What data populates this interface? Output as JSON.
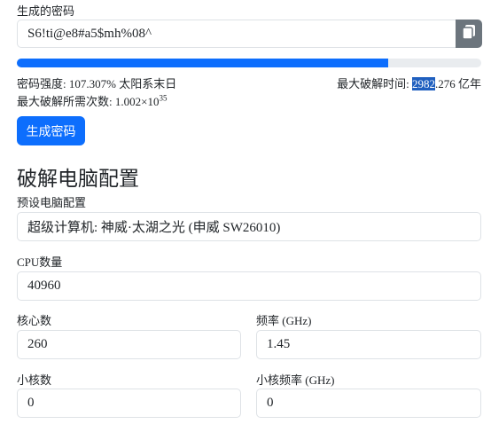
{
  "password": {
    "label": "生成的密码",
    "value": "S6!ti@e8#a5$mh%08^"
  },
  "strength": {
    "progress_fraction": 0.8,
    "strength_label": "密码强度:",
    "strength_value": "107.307%",
    "strength_level": "太阳系末日",
    "max_time_label": "最大破解时间:",
    "max_time_highlight": "2982",
    "max_time_rest": ".276 亿年",
    "attempts_label": "最大破解所需次数:",
    "attempts_mantissa": "1.002",
    "attempts_times": "×10",
    "attempts_exponent": "35"
  },
  "generate_button": "生成密码",
  "section_title": "破解电脑配置",
  "preset": {
    "label": "预设电脑配置",
    "value": "超级计算机: 神威·太湖之光 (申威 SW26010)"
  },
  "cpu_count": {
    "label": "CPU数量",
    "value": "40960"
  },
  "cores": {
    "label": "核心数",
    "value": "260"
  },
  "frequency": {
    "label": "频率 (GHz)",
    "value": "1.45"
  },
  "small_cores": {
    "label": "小核数",
    "value": "0"
  },
  "small_frequency": {
    "label": "小核频率 (GHz)",
    "value": "0"
  },
  "colors": {
    "primary": "#0d6efd",
    "secondary": "#6c757d",
    "track": "#e9ecef"
  },
  "icons": {
    "copy": "copy-icon"
  }
}
